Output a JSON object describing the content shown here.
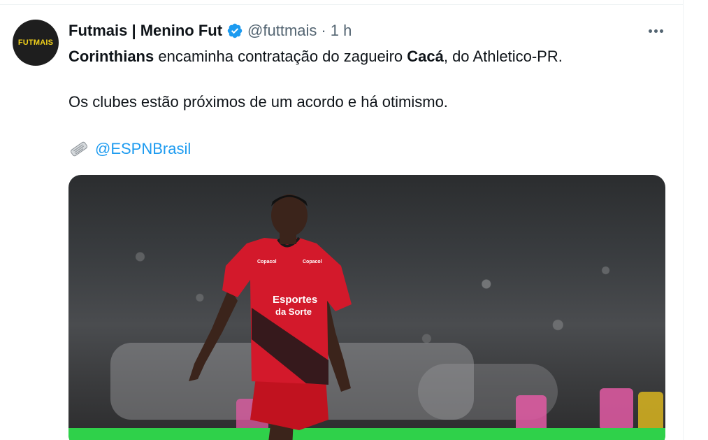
{
  "tweet": {
    "avatar_text": "FUTMAIS",
    "display_name": "Futmais | Menino Fut",
    "handle": "@futtmais",
    "separator": "·",
    "time": "1 h",
    "line1": {
      "part1": "Corinthians",
      "part2": " encaminha contratação do zagueiro ",
      "part3": "Cacá",
      "part4": ", do Athletico-PR."
    },
    "line2": "Os clubes estão próximos de um acordo e há otimismo.",
    "mention": "@ESPNBrasil",
    "media": {
      "sponsor_top_left": "Copacol",
      "sponsor_top_right": "Copacol",
      "shirt_line1": "Esportes",
      "shirt_line2": "da Sorte"
    }
  },
  "colors": {
    "link": "#1d9bf0",
    "verified": "#1d9bf0",
    "muted": "#536471",
    "jersey_red": "#d3192b"
  },
  "icons": {
    "verified": "verified-badge-icon",
    "more": "more-options-icon",
    "newspaper": "rolled-newspaper-icon"
  }
}
